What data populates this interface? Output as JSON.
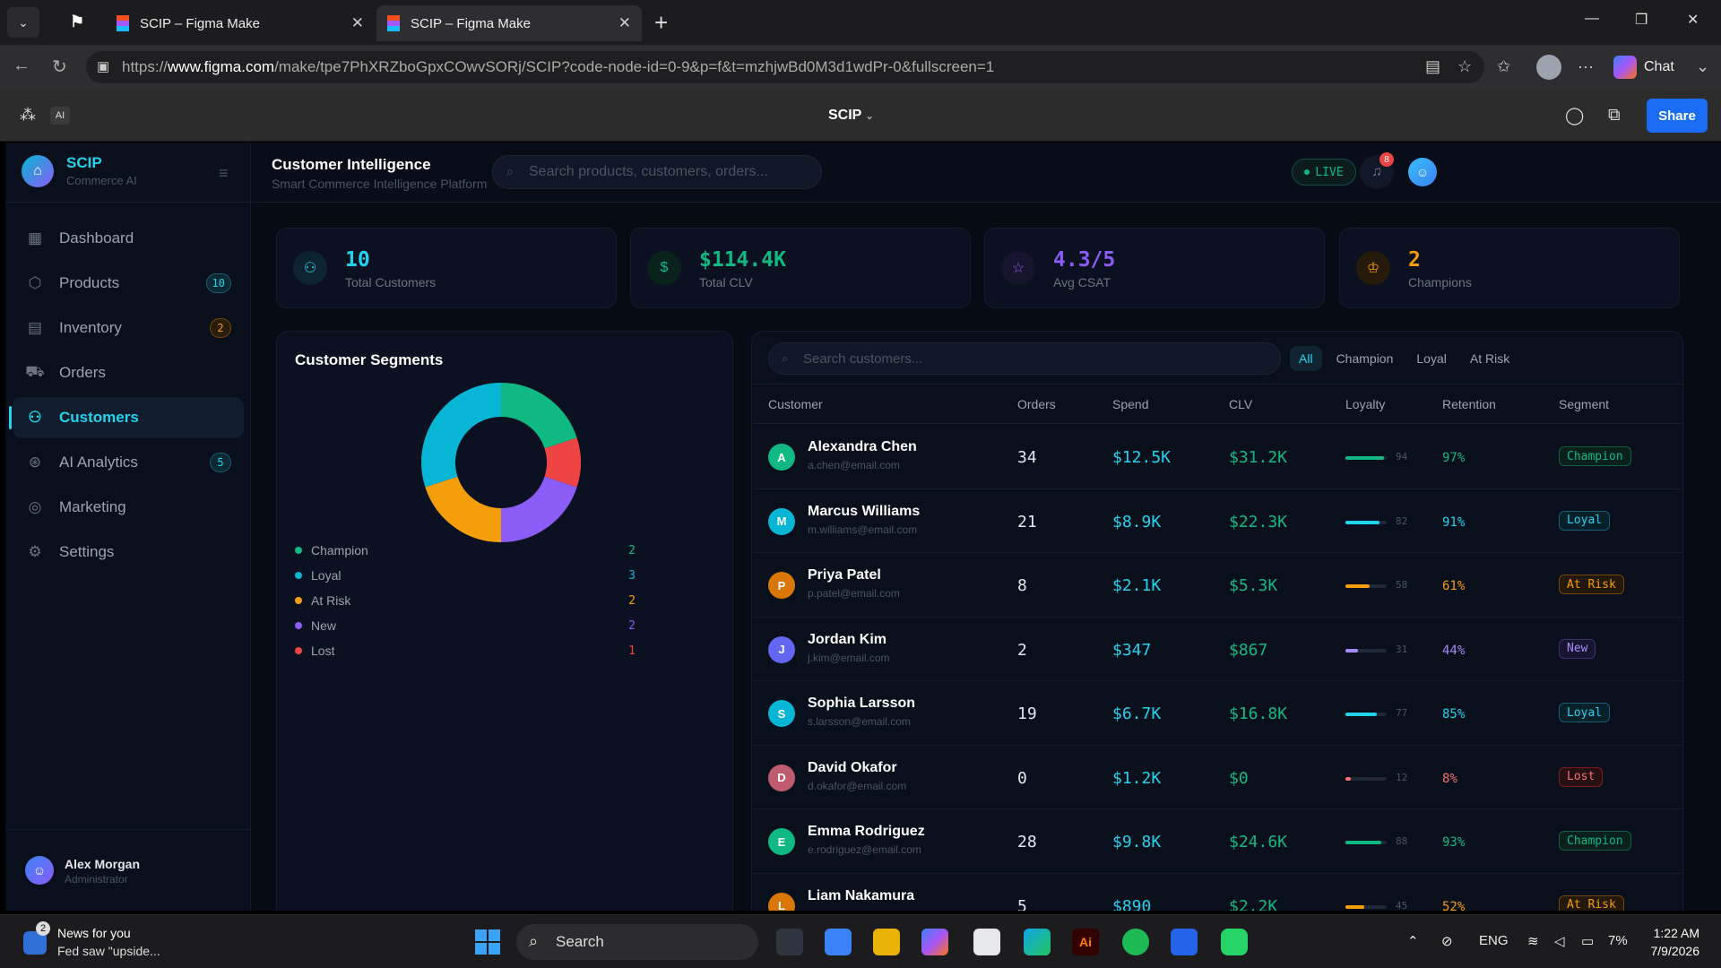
{
  "browser": {
    "tabs": [
      {
        "title": "SCIP – Figma Make",
        "active": false
      },
      {
        "title": "SCIP – Figma Make",
        "active": true
      }
    ],
    "url_prefix": "https://",
    "url_domain": "www.figma.com",
    "url_path": "/make/tpe7PhXRZboGpxCOwvSORj/SCIP?code-node-id=0-9&p=f&t=mzhjwBd0M3d1wdPr-0&fullscreen=1",
    "chat_label": "Chat"
  },
  "figma": {
    "ai_label": "AI",
    "file_title": "SCIP",
    "share_label": "Share"
  },
  "sidebar": {
    "brand_name": "SCIP",
    "brand_sub": "Commerce AI",
    "items": [
      {
        "label": "Dashboard",
        "icon": "grid-icon",
        "badge": null
      },
      {
        "label": "Products",
        "icon": "box-icon",
        "badge": "10"
      },
      {
        "label": "Inventory",
        "icon": "inventory-icon",
        "badge": "2"
      },
      {
        "label": "Orders",
        "icon": "cart-icon",
        "badge": null
      },
      {
        "label": "Customers",
        "icon": "users-icon",
        "badge": null,
        "active": true
      },
      {
        "label": "AI Analytics",
        "icon": "brain-icon",
        "badge": "5"
      },
      {
        "label": "Marketing",
        "icon": "target-icon",
        "badge": null
      },
      {
        "label": "Settings",
        "icon": "gear-icon",
        "badge": null
      }
    ],
    "user_name": "Alex Morgan",
    "user_role": "Administrator"
  },
  "header": {
    "title": "Customer Intelligence",
    "subtitle": "Smart Commerce Intelligence Platform",
    "search_placeholder": "Search products, customers, orders...",
    "live_label": "LIVE",
    "notification_count": "8"
  },
  "stats": [
    {
      "value": "10",
      "label": "Total Customers",
      "color": "#22d3ee"
    },
    {
      "value": "$114.4K",
      "label": "Total CLV",
      "color": "#10b981"
    },
    {
      "value": "4.3/5",
      "label": "Avg CSAT",
      "color": "#8b5cf6"
    },
    {
      "value": "2",
      "label": "Champions",
      "color": "#f59e0b"
    }
  ],
  "segments": {
    "title": "Customer Segments"
  },
  "chart_data": {
    "type": "pie",
    "title": "Customer Segments",
    "categories": [
      "Champion",
      "Loyal",
      "At Risk",
      "New",
      "Lost"
    ],
    "values": [
      2,
      3,
      2,
      2,
      1
    ],
    "colors": [
      "#10b981",
      "#06b6d4",
      "#f59e0b",
      "#8b5cf6",
      "#ef4444"
    ],
    "order_clockwise_from_top": [
      "Champion",
      "Lost",
      "New",
      "At Risk",
      "Loyal"
    ],
    "donut": true
  },
  "customers": {
    "search_placeholder": "Search customers...",
    "filters": [
      "All",
      "Champion",
      "Loyal",
      "At Risk"
    ],
    "active_filter": "All",
    "columns": [
      "Customer",
      "Orders",
      "Spend",
      "CLV",
      "Loyalty",
      "Retention",
      "Segment"
    ],
    "rows": [
      {
        "initial": "A",
        "name": "Alexandra Chen",
        "email": "a.chen@email.com",
        "orders": "34",
        "spend": "$12.5K",
        "clv": "$31.2K",
        "loyalty": 94,
        "loyalty_label": "94",
        "retention": "97%",
        "segment": "Champion",
        "avatar_color": "#10b981"
      },
      {
        "initial": "M",
        "name": "Marcus Williams",
        "email": "m.williams@email.com",
        "orders": "21",
        "spend": "$8.9K",
        "clv": "$22.3K",
        "loyalty": 82,
        "loyalty_label": "82",
        "retention": "91%",
        "segment": "Loyal",
        "avatar_color": "#06b6d4"
      },
      {
        "initial": "P",
        "name": "Priya Patel",
        "email": "p.patel@email.com",
        "orders": "8",
        "spend": "$2.1K",
        "clv": "$5.3K",
        "loyalty": 58,
        "loyalty_label": "58",
        "retention": "61%",
        "segment": "At Risk",
        "avatar_color": "#d97706"
      },
      {
        "initial": "J",
        "name": "Jordan Kim",
        "email": "j.kim@email.com",
        "orders": "2",
        "spend": "$347",
        "clv": "$867",
        "loyalty": 31,
        "loyalty_label": "31",
        "retention": "44%",
        "segment": "New",
        "avatar_color": "#6366f1"
      },
      {
        "initial": "S",
        "name": "Sophia Larsson",
        "email": "s.larsson@email.com",
        "orders": "19",
        "spend": "$6.7K",
        "clv": "$16.8K",
        "loyalty": 77,
        "loyalty_label": "77",
        "retention": "85%",
        "segment": "Loyal",
        "avatar_color": "#06b6d4"
      },
      {
        "initial": "D",
        "name": "David Okafor",
        "email": "d.okafor@email.com",
        "orders": "0",
        "spend": "$1.2K",
        "clv": "$0",
        "loyalty": 12,
        "loyalty_label": "12",
        "retention": "8%",
        "segment": "Lost",
        "avatar_color": "#be5b6f"
      },
      {
        "initial": "E",
        "name": "Emma Rodriguez",
        "email": "e.rodriguez@email.com",
        "orders": "28",
        "spend": "$9.8K",
        "clv": "$24.6K",
        "loyalty": 88,
        "loyalty_label": "88",
        "retention": "93%",
        "segment": "Champion",
        "avatar_color": "#10b981"
      },
      {
        "initial": "L",
        "name": "Liam Nakamura",
        "email": "",
        "orders": "5",
        "spend": "$890",
        "clv": "$2.2K",
        "loyalty": 45,
        "loyalty_label": "45",
        "retention": "52%",
        "segment": "At Risk",
        "avatar_color": "#d97706"
      }
    ]
  },
  "segment_styles": {
    "Champion": {
      "color": "#10b981",
      "bg": "#0a201a",
      "border": "#115e45"
    },
    "Loyal": {
      "color": "#22d3ee",
      "bg": "#08202a",
      "border": "#155e75"
    },
    "At Risk": {
      "color": "#f59e0b",
      "bg": "#24180a",
      "border": "#78450f"
    },
    "New": {
      "color": "#a78bfa",
      "bg": "#171430",
      "border": "#3b3270"
    },
    "Lost": {
      "color": "#f87171",
      "bg": "#261014",
      "border": "#7f1d1d"
    }
  },
  "taskbar": {
    "news_title": "News for you",
    "news_sub": "Fed saw \"upside...",
    "news_badge": "2",
    "search_label": "Search",
    "language": "ENG",
    "battery": "7%",
    "time": "1:22 AM",
    "date": "7/9/2026"
  }
}
